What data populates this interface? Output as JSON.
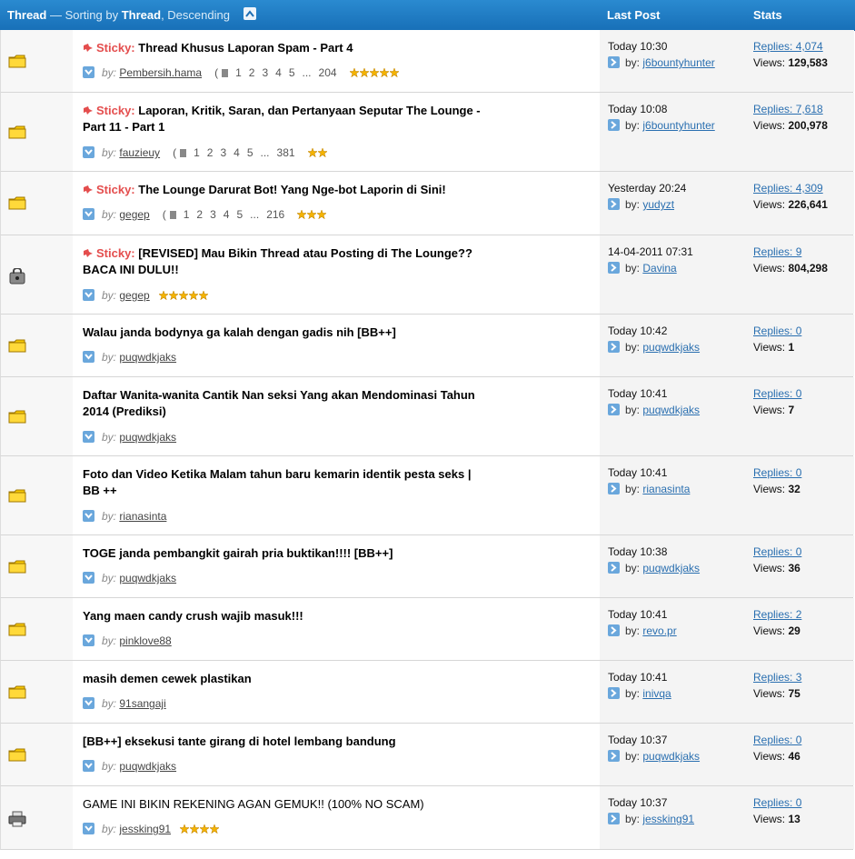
{
  "header": {
    "thread_label": "Thread",
    "sorting_text": " — Sorting by ",
    "sort_field": "Thread",
    "sort_order": ", Descending",
    "last_post_label": "Last Post",
    "stats_label": "Stats"
  },
  "colors": {
    "header_bg": "#1f7cc3",
    "sticky": "#e44d4d",
    "link": "#2a6fb0"
  },
  "threads": [
    {
      "sticky_label": "Sticky:",
      "title": "Thread Khusus Laporan Spam - Part 4",
      "by_label": "by:",
      "author": "Pembersih.hama",
      "pages": [
        "1",
        "2",
        "3",
        "4",
        "5",
        "...",
        "204"
      ],
      "stars": 5,
      "last_date": "Today 10:30",
      "last_by_label": "by:",
      "last_user": "j6bountyhunter",
      "replies": "Replies: 4,074",
      "views_label": "Views:",
      "views": "129,583",
      "icon": "folder-icon"
    },
    {
      "sticky_label": "Sticky:",
      "title": "Laporan, Kritik, Saran, dan Pertanyaan Seputar The Lounge - Part 11 - Part 1",
      "by_label": "by:",
      "author": "fauzieuy",
      "pages": [
        "1",
        "2",
        "3",
        "4",
        "5",
        "...",
        "381"
      ],
      "stars": 2,
      "last_date": "Today 10:08",
      "last_by_label": "by:",
      "last_user": "j6bountyhunter",
      "replies": "Replies: 7,618",
      "views_label": "Views:",
      "views": "200,978",
      "icon": "folder-icon"
    },
    {
      "sticky_label": "Sticky:",
      "title": "The Lounge Darurat Bot! Yang Nge-bot Laporin di Sini!",
      "by_label": "by:",
      "author": "gegep",
      "pages": [
        "1",
        "2",
        "3",
        "4",
        "5",
        "...",
        "216"
      ],
      "stars": 3,
      "last_date": "Yesterday 20:24",
      "last_by_label": "by:",
      "last_user": "yudyzt",
      "replies": "Replies: 4,309",
      "views_label": "Views:",
      "views": "226,641",
      "icon": "folder-icon"
    },
    {
      "sticky_label": "Sticky:",
      "title": "[REVISED] Mau Bikin Thread atau Posting di The Lounge?? BACA INI DULU!!",
      "by_label": "by:",
      "author": "gegep",
      "pages": [],
      "stars": 5,
      "last_date": "14-04-2011 07:31",
      "last_by_label": "by:",
      "last_user": "Davina",
      "replies": "Replies: 9",
      "views_label": "Views:",
      "views": "804,298",
      "icon": "lock-icon"
    },
    {
      "title": "Walau janda bodynya ga kalah dengan gadis nih [BB++]",
      "by_label": "by:",
      "author": "puqwdkjaks",
      "last_date": "Today 10:42",
      "last_by_label": "by:",
      "last_user": "puqwdkjaks",
      "replies": "Replies: 0",
      "views_label": "Views:",
      "views": "1",
      "icon": "folder-icon"
    },
    {
      "title": "Daftar Wanita-wanita Cantik Nan seksi Yang akan Mendominasi Tahun 2014 (Prediksi)",
      "by_label": "by:",
      "author": "puqwdkjaks",
      "last_date": "Today 10:41",
      "last_by_label": "by:",
      "last_user": "puqwdkjaks",
      "replies": "Replies: 0",
      "views_label": "Views:",
      "views": "7",
      "icon": "folder-icon"
    },
    {
      "title": "Foto dan Video Ketika Malam tahun baru kemarin identik pesta seks | BB ++",
      "by_label": "by:",
      "author": "rianasinta",
      "last_date": "Today 10:41",
      "last_by_label": "by:",
      "last_user": "rianasinta",
      "replies": "Replies: 0",
      "views_label": "Views:",
      "views": "32",
      "icon": "folder-icon",
      "starred": true
    },
    {
      "title": "TOGE janda pembangkit gairah pria buktikan!!!! [BB++]",
      "by_label": "by:",
      "author": "puqwdkjaks",
      "last_date": "Today 10:38",
      "last_by_label": "by:",
      "last_user": "puqwdkjaks",
      "replies": "Replies: 0",
      "views_label": "Views:",
      "views": "36",
      "icon": "folder-icon"
    },
    {
      "title": "Yang maen candy crush wajib masuk!!!",
      "by_label": "by:",
      "author": "pinklove88",
      "last_date": "Today 10:41",
      "last_by_label": "by:",
      "last_user": "revo.pr",
      "replies": "Replies: 2",
      "views_label": "Views:",
      "views": "29",
      "icon": "folder-icon"
    },
    {
      "title": "masih demen cewek plastikan",
      "by_label": "by:",
      "author": "91sangaji",
      "last_date": "Today 10:41",
      "last_by_label": "by:",
      "last_user": "inivqa",
      "replies": "Replies: 3",
      "views_label": "Views:",
      "views": "75",
      "icon": "folder-icon"
    },
    {
      "title": "[BB++] eksekusi tante girang di hotel lembang bandung",
      "by_label": "by:",
      "author": "puqwdkjaks",
      "last_date": "Today 10:37",
      "last_by_label": "by:",
      "last_user": "puqwdkjaks",
      "replies": "Replies: 0",
      "views_label": "Views:",
      "views": "46",
      "icon": "folder-icon"
    },
    {
      "title": "GAME INI BIKIN REKENING AGAN GEMUK!! (100% NO SCAM)",
      "by_label": "by:",
      "author": "jessking91",
      "stars": 4,
      "last_date": "Today 10:37",
      "last_by_label": "by:",
      "last_user": "jessking91",
      "replies": "Replies: 0",
      "views_label": "Views:",
      "views": "13",
      "icon": "printer-icon",
      "title_normal": true
    }
  ]
}
